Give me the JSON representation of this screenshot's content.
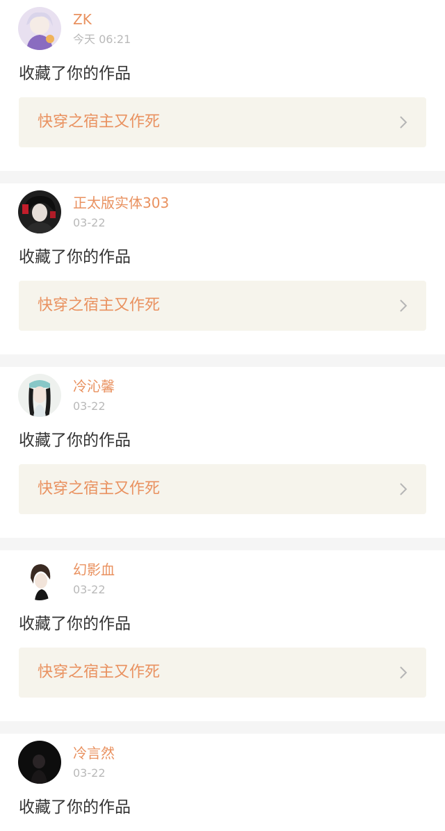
{
  "notifications": [
    {
      "username": "ZK",
      "time": "今天 06:21",
      "action": "收藏了你的作品",
      "work_title": "快穿之宿主又作死"
    },
    {
      "username": "正太版实体303",
      "time": "03-22",
      "action": "收藏了你的作品",
      "work_title": "快穿之宿主又作死"
    },
    {
      "username": "冷沁馨",
      "time": "03-22",
      "action": "收藏了你的作品",
      "work_title": "快穿之宿主又作死"
    },
    {
      "username": "幻影血",
      "time": "03-22",
      "action": "收藏了你的作品",
      "work_title": "快穿之宿主又作死"
    },
    {
      "username": "冷言然",
      "time": "03-22",
      "action": "收藏了你的作品",
      "work_title": ""
    }
  ],
  "colors": {
    "accent": "#e9915f",
    "text": "#333333",
    "muted": "#b9b9b9",
    "work_bg": "#f6f4ec",
    "separator": "#f5f5f5"
  },
  "icons": {
    "chevron": "chevron-right-icon"
  }
}
